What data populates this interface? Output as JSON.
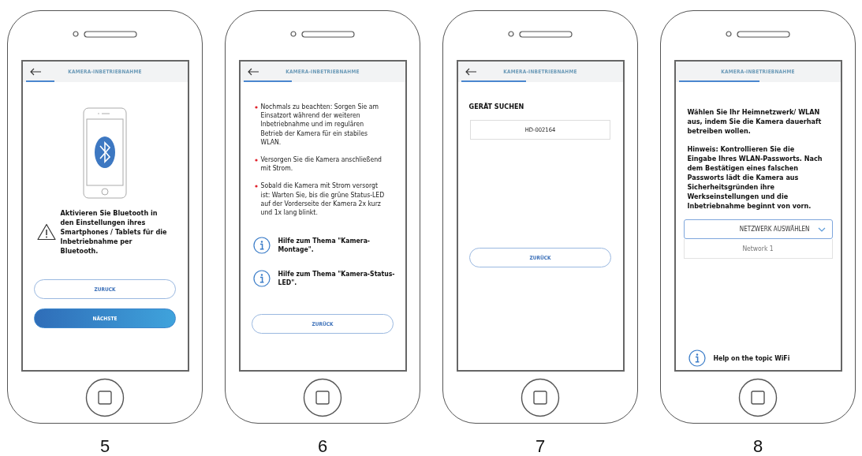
{
  "phones": [
    {
      "number": "5",
      "screen": {
        "kind": "bluetooth",
        "title": "KAMERA-INBETRIEBNAHME",
        "back": true,
        "level": 0.18,
        "blocks": [
          {
            "kind": "illustration"
          },
          {
            "kind": "warning",
            "text": "Aktivieren Sie Bluetooth in den Einstellungen ihres Smartphones / Tablets für die Inbetriebnahme per Bluetooth."
          },
          {
            "kind": "button",
            "label": "ZURUCK",
            "primary": false
          },
          {
            "kind": "button",
            "label": "NÄCHSTE",
            "primary": true
          }
        ]
      }
    },
    {
      "number": "6",
      "screen": {
        "kind": "info",
        "title": "KAMERA-INBETRIEBNAHME",
        "back": true,
        "level": 0.3,
        "blocks": [
          {
            "kind": "bullet",
            "text": "Nochmals zu beachten: Sorgen Sie am Einsatzort während der weiteren Inbetriebnahme und im regulären Betrieb der Kamera für ein stabiles WLAN."
          },
          {
            "kind": "bullet",
            "text": "Versorgen Sie die Kamera anschließend mit Strom."
          },
          {
            "kind": "bullet",
            "text": "Sobald die Kamera mit Strom versorgt ist: Warten Sie, bis die grüne Status-LED auf der Vorderseite der Kamera 2x kurz und 1x lang blinkt."
          },
          {
            "kind": "help",
            "text": "Hilfe zum Thema \"Kamera-Montage\"."
          },
          {
            "kind": "help",
            "text": "Hilfe zum Thema \"Kamera-Status-LED\"."
          },
          {
            "kind": "button",
            "label": "ZURÜCK",
            "primary": false
          }
        ]
      }
    },
    {
      "number": "7",
      "screen": {
        "kind": "search",
        "title": "KAMERA-INBETRIEBNAHME",
        "back": true,
        "level": 0.4,
        "blocks": [
          {
            "kind": "heading",
            "text": "GERÄT SUCHEN"
          },
          {
            "kind": "field",
            "value": "HD-002164"
          },
          {
            "kind": "button",
            "label": "ZURÜCK",
            "primary": false
          }
        ]
      }
    },
    {
      "number": "8",
      "screen": {
        "kind": "network",
        "title": "KAMERA-INBETRIEBNAHME",
        "back": false,
        "level": 0.5,
        "blocks": [
          {
            "kind": "paragraph",
            "text": "Wählen Sie Ihr Heimnetzwerk/ WLAN aus, indem Sie die Kamera dauerhaft betreiben wollen."
          },
          {
            "kind": "paragraph",
            "text": "Hinweis: Kontrollieren Sie die Eingabe Ihres WLAN-Passworts. Nach dem Bestätigen eines falschen Passworts lädt die Kamera aus Sicherheitsgründen ihre Werkseinstellungen und die Inbetriebnahme beginnt von vorn."
          },
          {
            "kind": "dropdown",
            "label": "NETZWERK AUSWÄHLEN",
            "expanded": true,
            "options": [
              "Network 1"
            ]
          },
          {
            "kind": "help",
            "text": "Help on the topic WiFi"
          }
        ]
      }
    }
  ]
}
